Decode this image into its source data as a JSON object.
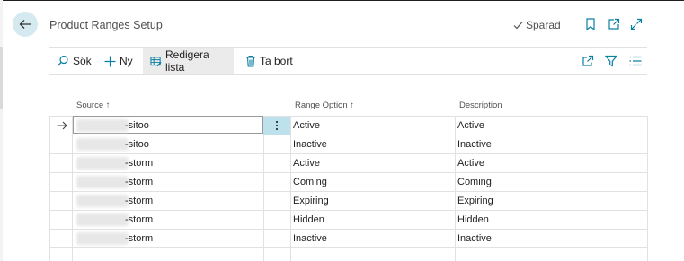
{
  "header": {
    "title": "Product Ranges Setup",
    "saved_label": "Sparad",
    "icons": [
      "back-arrow-icon",
      "checkmark-icon",
      "bookmark-icon",
      "open-new-window-icon",
      "expand-icon"
    ]
  },
  "actions": {
    "search": "Sök",
    "new": "Ny",
    "edit_list": "Redigera lista",
    "delete": "Ta bort"
  },
  "columns": {
    "source": "Source ↑",
    "range_option": "Range Option ↑",
    "description": "Description"
  },
  "rows": [
    {
      "source": "-sitoo",
      "range_option": "Active",
      "description": "Active"
    },
    {
      "source": "-sitoo",
      "range_option": "Inactive",
      "description": "Inactive"
    },
    {
      "source": "-storm",
      "range_option": "Active",
      "description": "Active"
    },
    {
      "source": "-storm",
      "range_option": "Coming",
      "description": "Coming"
    },
    {
      "source": "-storm",
      "range_option": "Expiring",
      "description": "Expiring"
    },
    {
      "source": "-storm",
      "range_option": "Hidden",
      "description": "Hidden"
    },
    {
      "source": "-storm",
      "range_option": "Inactive",
      "description": "Inactive"
    }
  ],
  "colors": {
    "accent": "#0a7fa4",
    "selected_cell": "#bde2ec",
    "back_button": "#d4e9f0"
  }
}
